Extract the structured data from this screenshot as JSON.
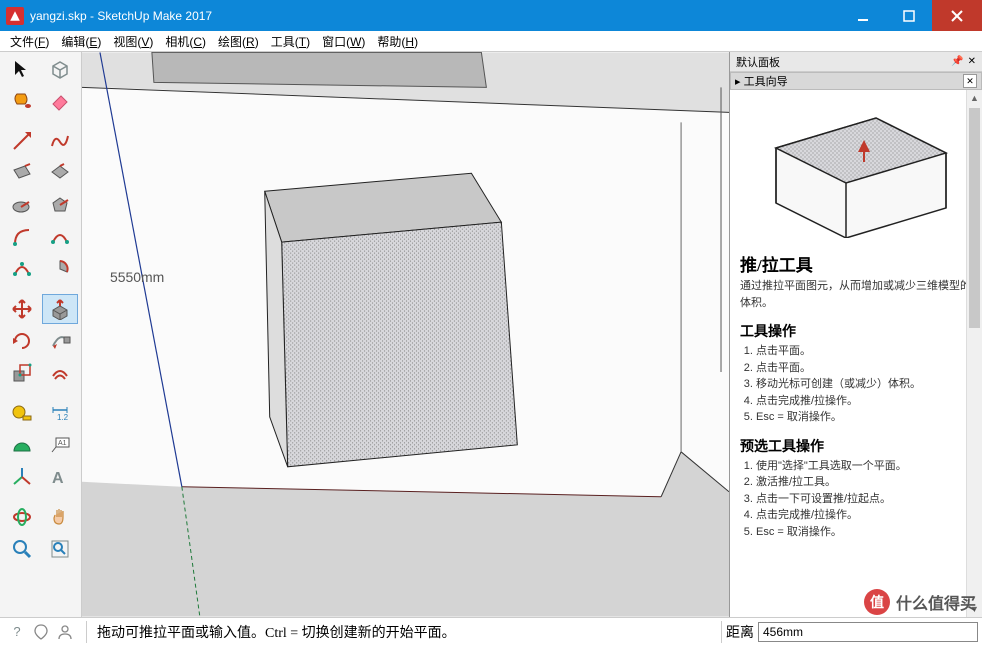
{
  "titlebar": {
    "text": "yangzi.skp - SketchUp Make 2017"
  },
  "menu": {
    "items": [
      {
        "label": "文件",
        "key": "F"
      },
      {
        "label": "编辑",
        "key": "E"
      },
      {
        "label": "视图",
        "key": "V"
      },
      {
        "label": "相机",
        "key": "C"
      },
      {
        "label": "绘图",
        "key": "R"
      },
      {
        "label": "工具",
        "key": "T"
      },
      {
        "label": "窗口",
        "key": "W"
      },
      {
        "label": "帮助",
        "key": "H"
      }
    ]
  },
  "viewport": {
    "dim_label": "5550mm"
  },
  "panel": {
    "header": "默认面板",
    "sub": "▸ 工具向导",
    "title": "推/拉工具",
    "desc": "通过推拉平面图元，从而增加或减少三维模型的体积。",
    "ops_h": "工具操作",
    "ops": [
      "点击平面。",
      "点击平面。",
      "移动光标可创建（或减少）体积。",
      "点击完成推/拉操作。",
      "Esc = 取消操作。"
    ],
    "pre_h": "预选工具操作",
    "pre": [
      "使用\"选择\"工具选取一个平面。",
      "激活推/拉工具。",
      "点击一下可设置推/拉起点。",
      "点击完成推/拉操作。",
      "Esc = 取消操作。"
    ]
  },
  "status": {
    "hint": "拖动可推拉平面或输入值。Ctrl = 切换创建新的开始平面。",
    "dist_label": "距离",
    "dist_value": "456mm"
  },
  "watermark": {
    "text": "什么值得买"
  }
}
